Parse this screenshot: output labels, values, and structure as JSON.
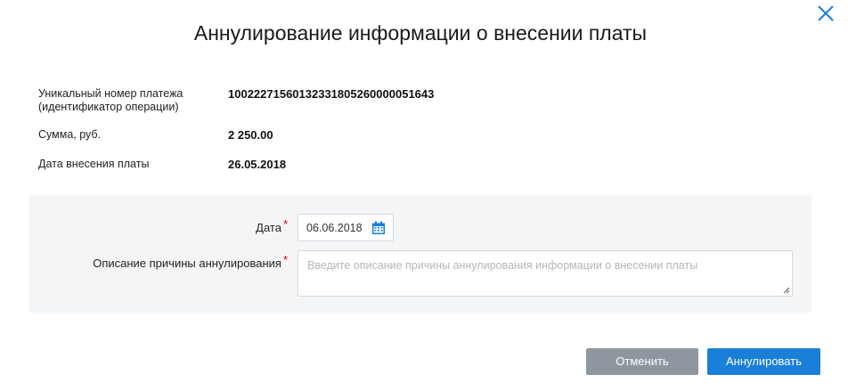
{
  "dialog": {
    "title": "Аннулирование информации о внесении платы"
  },
  "info": {
    "payment_id_label": "Уникальный номер платежа (идентификатор операции)",
    "payment_id_value": "10022271560132331805260000051643",
    "amount_label": "Сумма, руб.",
    "amount_value": "2 250.00",
    "date_label": "Дата внесения платы",
    "date_value": "26.05.2018"
  },
  "form": {
    "date_label": "Дата",
    "date_value": "06.06.2018",
    "reason_label": "Описание причины аннулирования",
    "reason_placeholder": "Введите описание причины аннулирования информации о внесении платы",
    "required_mark": "*"
  },
  "buttons": {
    "cancel_label": "Отменить",
    "annul_label": "Аннулировать"
  },
  "colors": {
    "accent": "#1a7fd6",
    "cancel": "#8e979f",
    "panel": "#f3f5f7",
    "required": "#d0021b"
  },
  "icons": {
    "close": "close-icon",
    "calendar": "calendar-icon"
  }
}
